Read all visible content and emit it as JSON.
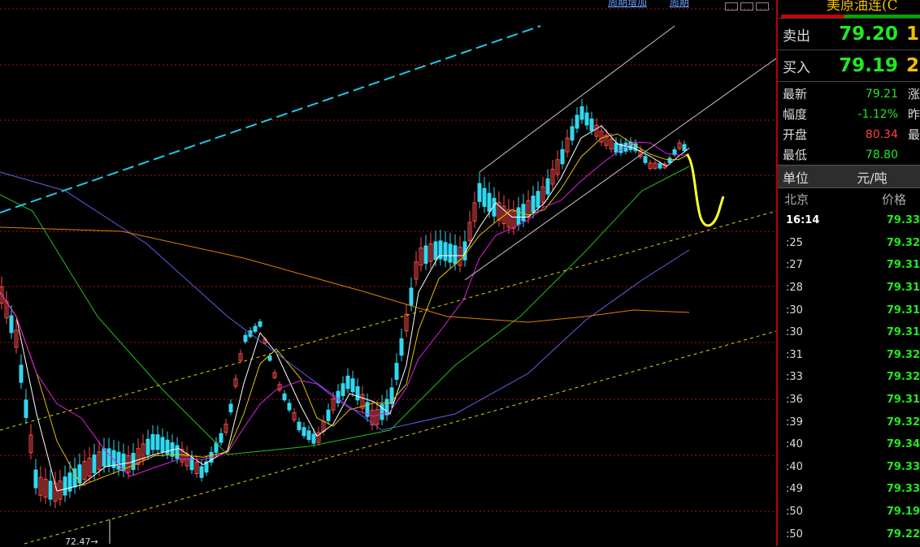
{
  "chart": {
    "top_links": [
      "周期增加",
      "周期"
    ],
    "low_marker": "72.47→",
    "colors": {
      "up": "#ff4a4a",
      "down": "#30d8f0",
      "ma5": "#ffffff",
      "ma10": "#e0c000",
      "ma20": "#e020e0",
      "ma60": "#20c020",
      "ma120": "#6060f0",
      "ma250": "#e08000",
      "trend": "#e0d000",
      "channel": "#c8c8c8",
      "cyan_line": "#20c8e0",
      "grid": "#a01818",
      "forecast": "#ffff30"
    }
  },
  "panel": {
    "title": "美原油连(C",
    "sell": {
      "label": "卖出",
      "price": "79.20",
      "vol": "1"
    },
    "buy": {
      "label": "买入",
      "price": "79.19",
      "vol": "2"
    },
    "stats": [
      {
        "label": "最新",
        "value": "79.21",
        "color": "green",
        "extra": "涨"
      },
      {
        "label": "幅度",
        "value": "-1.12%",
        "color": "green",
        "extra": "昨"
      },
      {
        "label": "开盘",
        "value": "80.34",
        "color": "red",
        "extra": "最"
      },
      {
        "label": "最低",
        "value": "78.80",
        "color": "green",
        "extra": ""
      }
    ],
    "unit": {
      "label": "单位",
      "value": "元/吨"
    },
    "ticks_header": {
      "left": "北京",
      "right": "价格"
    },
    "ticks": [
      {
        "time": "16:14",
        "price": "79.33"
      },
      {
        "time": ":25",
        "price": "79.32"
      },
      {
        "time": ":27",
        "price": "79.31"
      },
      {
        "time": ":28",
        "price": "79.31"
      },
      {
        "time": ":30",
        "price": "79.31"
      },
      {
        "time": ":30",
        "price": "79.31"
      },
      {
        "time": ":31",
        "price": "79.32"
      },
      {
        "time": ":33",
        "price": "79.32"
      },
      {
        "time": ":36",
        "price": "79.31"
      },
      {
        "time": ":39",
        "price": "79.32"
      },
      {
        "time": ":40",
        "price": "79.34"
      },
      {
        "time": ":40",
        "price": "79.33"
      },
      {
        "time": ":49",
        "price": "79.33"
      },
      {
        "time": ":50",
        "price": "79.19"
      },
      {
        "time": ":50",
        "price": "79.22"
      }
    ]
  }
}
